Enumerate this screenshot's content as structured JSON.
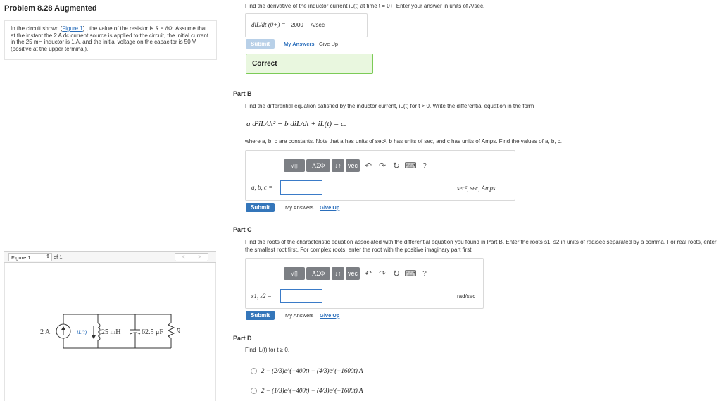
{
  "problem_title": "Problem 8.28 Augmented",
  "intro": {
    "p1": "In the circuit shown (",
    "figure_link": "Figure 1",
    "p2": ") , the value of the resistor is ",
    "r_val": "R = 8Ω",
    "p3": ". Assume that at the instant the 2 A dc current source is applied to the circuit, the initial current in the 25 mH inductor is 1 A, and the initial voltage on the capacitor is 50 V (positive at the upper terminal)."
  },
  "figure": {
    "select_label": "Figure 1",
    "of_label": "of 1",
    "prev": "<",
    "next": ">",
    "labels": {
      "source": "2 A",
      "inductor_current": "iL(t)",
      "inductor": "25 mH",
      "capacitor": "62.5 μF",
      "resistor": "R"
    }
  },
  "partA": {
    "question": "Find the derivative of the inductor current iL(t) at time t = 0+. Enter your answer in units of A/sec.",
    "answer_lhs": "diL/dt (0+) =",
    "answer_value": "2000",
    "answer_unit": "A/sec",
    "submit": "Submit",
    "my_answers": "My Answers",
    "give_up": "Give Up",
    "result": "Correct"
  },
  "partB": {
    "title": "Part B",
    "question": "Find the differential equation satisfied by the inductor current, iL(t) for t > 0. Write the differential equation in the form",
    "equation": "a d²iL/dt² + b diL/dt + iL(t) = c.",
    "note": "where a, b, c are constants. Note that a has units of sec², b has units of sec, and c has units of Amps. Find the values of a, b, c.",
    "input_label": "a, b, c =",
    "input_value": "",
    "units": "sec², sec, Amps",
    "submit": "Submit",
    "my_answers": "My Answers",
    "give_up": "Give Up"
  },
  "partC": {
    "title": "Part C",
    "question": "Find the roots of the characteristic equation associated with the differential equation you found in Part B. Enter the roots s1, s2 in units of rad/sec separated by a comma. For real roots, enter the smallest root first. For complex roots, enter the root with the positive imaginary part first.",
    "input_label": "s1, s2 =",
    "input_value": "",
    "units": "rad/sec",
    "submit": "Submit",
    "my_answers": "My Answers",
    "give_up": "Give Up"
  },
  "partD": {
    "title": "Part D",
    "question": "Find iL(t) for t ≥ 0.",
    "options": [
      "2 − (2/3)e^(−400t) − (4/3)e^(−1600t) A",
      "2 − (1/3)e^(−400t) − (4/3)e^(−1600t) A"
    ]
  },
  "toolbar": {
    "templates": "√▯",
    "greek": "ΑΣΦ",
    "arrows": "↓↑",
    "vec": "vec",
    "help": "?"
  },
  "colors": {
    "accent": "#3476ba",
    "correct_bg": "#e9f7df",
    "correct_border": "#7ccb57",
    "link": "#2a6ebb"
  }
}
